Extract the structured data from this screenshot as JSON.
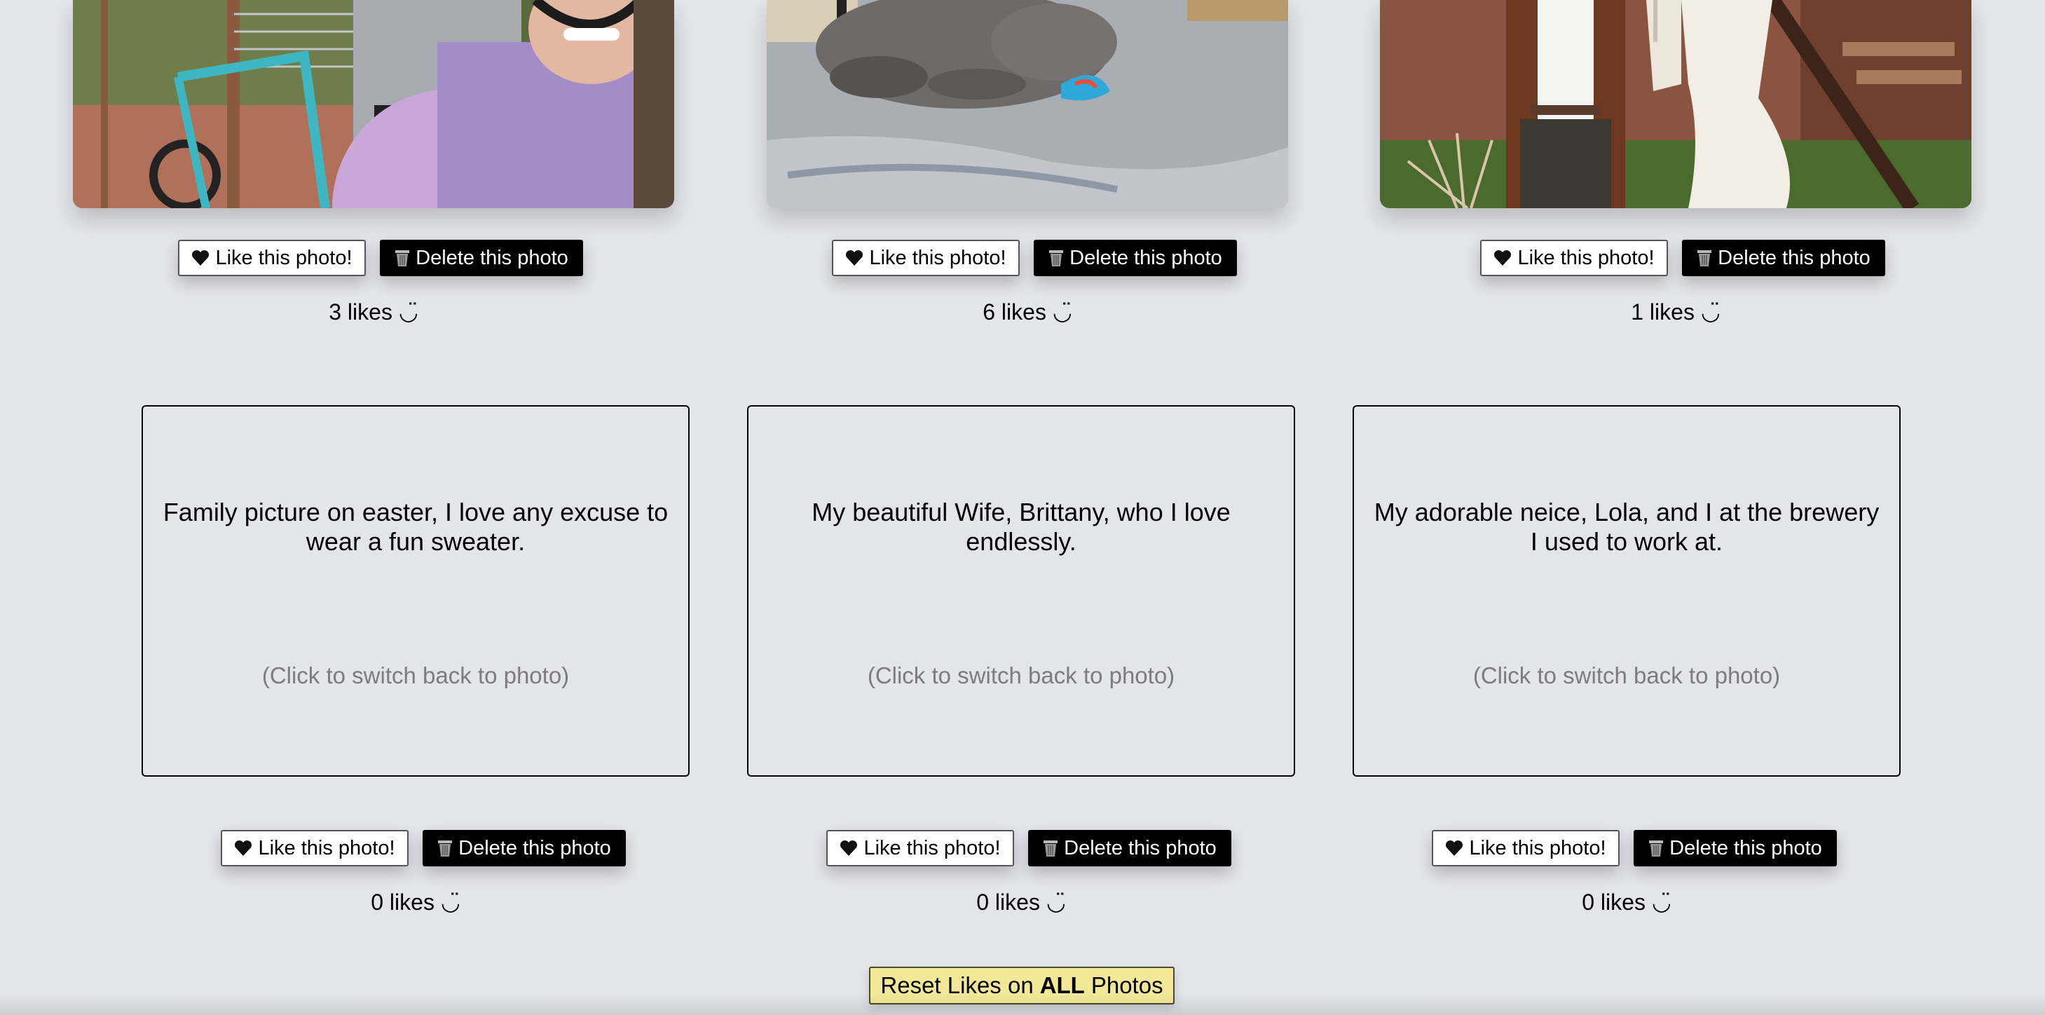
{
  "photos": [
    {
      "likes_count": "3",
      "like_label": "Like this photo!",
      "delete_label": "Delete this photo",
      "likes_suffix": "likes ◡̈"
    },
    {
      "likes_count": "6",
      "like_label": "Like this photo!",
      "delete_label": "Delete this photo",
      "likes_suffix": "likes ◡̈"
    },
    {
      "likes_count": "1",
      "like_label": "Like this photo!",
      "delete_label": "Delete this photo",
      "likes_suffix": "likes ◡̈"
    }
  ],
  "text_cards": [
    {
      "caption": "Family picture on easter, I love any excuse to wear a fun sweater.",
      "hint": "(Click to switch back to photo)",
      "like_label": "Like this photo!",
      "delete_label": "Delete this photo",
      "likes_count": "0",
      "likes_suffix": "likes ◡̈"
    },
    {
      "caption": "My beautiful Wife, Brittany, who I love endlessly.",
      "hint": "(Click to switch back to photo)",
      "like_label": "Like this photo!",
      "delete_label": "Delete this photo",
      "likes_count": "0",
      "likes_suffix": "likes ◡̈"
    },
    {
      "caption": "My adorable neice, Lola, and I at the brewery I used to work at.",
      "hint": "(Click to switch back to photo)",
      "like_label": "Like this photo!",
      "delete_label": "Delete this photo",
      "likes_count": "0",
      "likes_suffix": "likes ◡̈"
    }
  ],
  "reset": {
    "prefix": "Reset Likes on",
    "emphasis": "ALL",
    "suffix": "Photos"
  },
  "colors": {
    "background": "#e4e5ea",
    "reset_button": "#f2e898",
    "delete_button": "#000000",
    "like_button": "#ffffff",
    "hint_text": "#7c7c7c"
  },
  "icons": {
    "like": "black-heart-icon",
    "delete": "wastebasket-icon"
  }
}
